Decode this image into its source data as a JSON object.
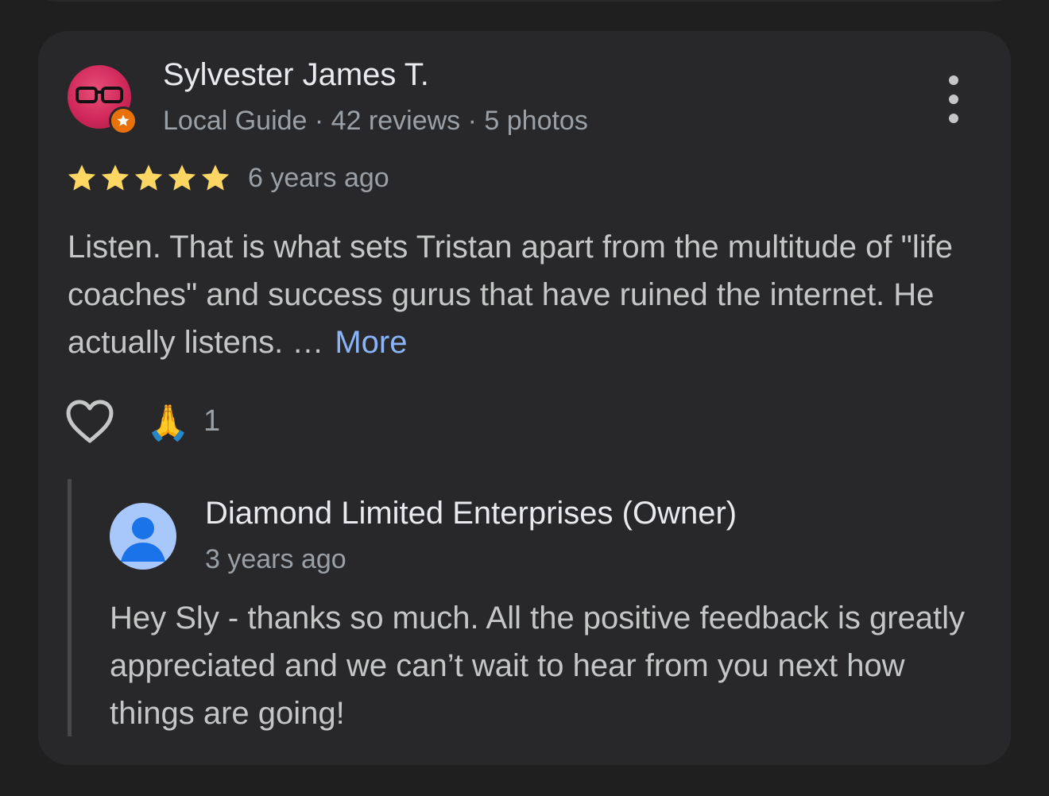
{
  "review": {
    "author_name": "Sylvester James T.",
    "author_meta": "Local Guide · 42 reviews · 5 photos",
    "rating": 5,
    "time": "6 years ago",
    "text": "Listen. That is what sets Tristan apart from the multitude of \"life coaches\" and success gurus that have ruined the internet. He actually listens. …",
    "more_label": "More",
    "reaction_emoji": "🙏",
    "reaction_count": "1"
  },
  "owner_reply": {
    "name": "Diamond Limited Enterprises (Owner)",
    "time": "3 years ago",
    "text": "Hey Sly - thanks so much. All the positive feedback is greatly appreciated and we can’t wait to hear from you next how things are going!"
  },
  "icons": {
    "more": "more-vert-icon",
    "like": "heart-icon",
    "badge": "local-guide-star-icon",
    "owner_avatar": "person-icon"
  },
  "colors": {
    "card": "#28282a",
    "background": "#1f1f20",
    "star": "#fdd663",
    "link": "#8ab4f8",
    "badge": "#e8710a",
    "owner_avatar": "#a8c7fa"
  }
}
